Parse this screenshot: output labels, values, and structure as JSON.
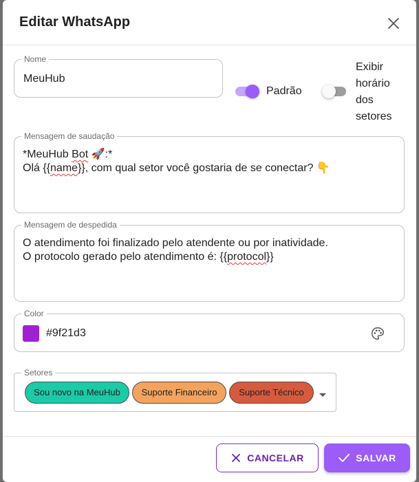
{
  "dialog": {
    "title": "Editar WhatsApp"
  },
  "form": {
    "name": {
      "legend": "Nome",
      "value": "MeuHub"
    },
    "default_switch": {
      "label": "Padrão",
      "checked": true
    },
    "show_hours_switch": {
      "label_lines": [
        "Exibir",
        "horário",
        "dos",
        "setores"
      ],
      "checked": false
    },
    "greeting": {
      "legend": "Mensagem de saudação",
      "line1_prefix": "*MeuHub ",
      "line1_word": "Bot",
      "line1_suffix": " 🚀:*",
      "line2_prefix": "Olá {{",
      "line2_word": "name",
      "line2_suffix": "}}, com qual setor você gostaria de se conectar? 👇"
    },
    "farewell": {
      "legend": "Mensagem de despedida",
      "line1": "O atendimento foi finalizado pelo atendente ou por inatividade.",
      "line2_prefix": "O protocolo gerado pelo atendimento é: {{",
      "line2_word": "protocol",
      "line2_suffix": "}}"
    },
    "color": {
      "legend": "Color",
      "value": "#9f21d3"
    },
    "sectors": {
      "legend": "Setores",
      "chips": [
        {
          "label": "Sou novo na MeuHub",
          "color": "#1ccaa8"
        },
        {
          "label": "Suporte Financeiro",
          "color": "#f4a35e"
        },
        {
          "label": "Suporte Técnico",
          "color": "#d65a3e"
        }
      ]
    }
  },
  "footer": {
    "cancel_label": "CANCELAR",
    "save_label": "SALVAR"
  },
  "colors": {
    "accent": "#9b5cf7",
    "accent_dark": "#6a1fb0",
    "switch_off": "#9e9e9e"
  },
  "icons": {
    "close": "close-icon",
    "palette": "palette-icon",
    "cancel": "close-icon",
    "save": "check-icon",
    "caret": "caret-down-icon"
  }
}
